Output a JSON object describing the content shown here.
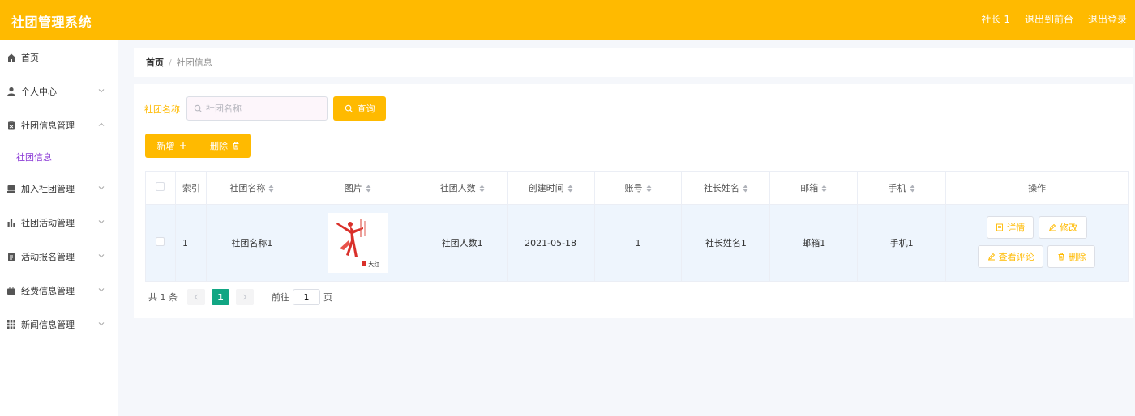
{
  "header": {
    "title": "社团管理系统",
    "user": "社长 1",
    "back_front": "退出到前台",
    "logout": "退出登录"
  },
  "sidebar": {
    "items": [
      {
        "label": "首页",
        "icon": "home-icon"
      },
      {
        "label": "个人中心",
        "icon": "user-icon"
      },
      {
        "label": "社团信息管理",
        "icon": "clipboard-icon",
        "expanded": true
      },
      {
        "label": "加入社团管理",
        "icon": "folder-icon"
      },
      {
        "label": "社团活动管理",
        "icon": "bar-chart-icon"
      },
      {
        "label": "活动报名管理",
        "icon": "document-icon"
      },
      {
        "label": "经费信息管理",
        "icon": "briefcase-icon"
      },
      {
        "label": "新闻信息管理",
        "icon": "grid-icon"
      }
    ],
    "submenu_label": "社团信息"
  },
  "breadcrumb": {
    "home": "首页",
    "separator": "/",
    "current": "社团信息"
  },
  "search": {
    "label": "社团名称",
    "placeholder": "社团名称",
    "query_button": "查询"
  },
  "toolbar": {
    "add_label": "新增",
    "delete_label": "删除"
  },
  "table": {
    "headers": {
      "index": "索引",
      "name": "社团名称",
      "image": "图片",
      "members": "社团人数",
      "created": "创建时间",
      "account": "账号",
      "leader": "社长姓名",
      "email": "邮箱",
      "phone": "手机",
      "ops": "操作"
    },
    "rows": [
      {
        "index": "1",
        "name": "社团名称1",
        "image_caption": "大红",
        "members": "社团人数1",
        "created": "2021-05-18",
        "account": "1",
        "leader": "社长姓名1",
        "email": "邮箱1",
        "phone": "手机1"
      }
    ],
    "ops": {
      "detail": "详情",
      "edit": "修改",
      "comment": "查看评论",
      "delete": "删除"
    }
  },
  "pagination": {
    "total": "共 1 条",
    "current_page": "1",
    "goto_prefix": "前往",
    "goto_value": "1",
    "goto_suffix": "页"
  },
  "colors": {
    "primary": "#ffba00",
    "page_active": "#11a683",
    "submenu_active": "#8b3ad6"
  }
}
